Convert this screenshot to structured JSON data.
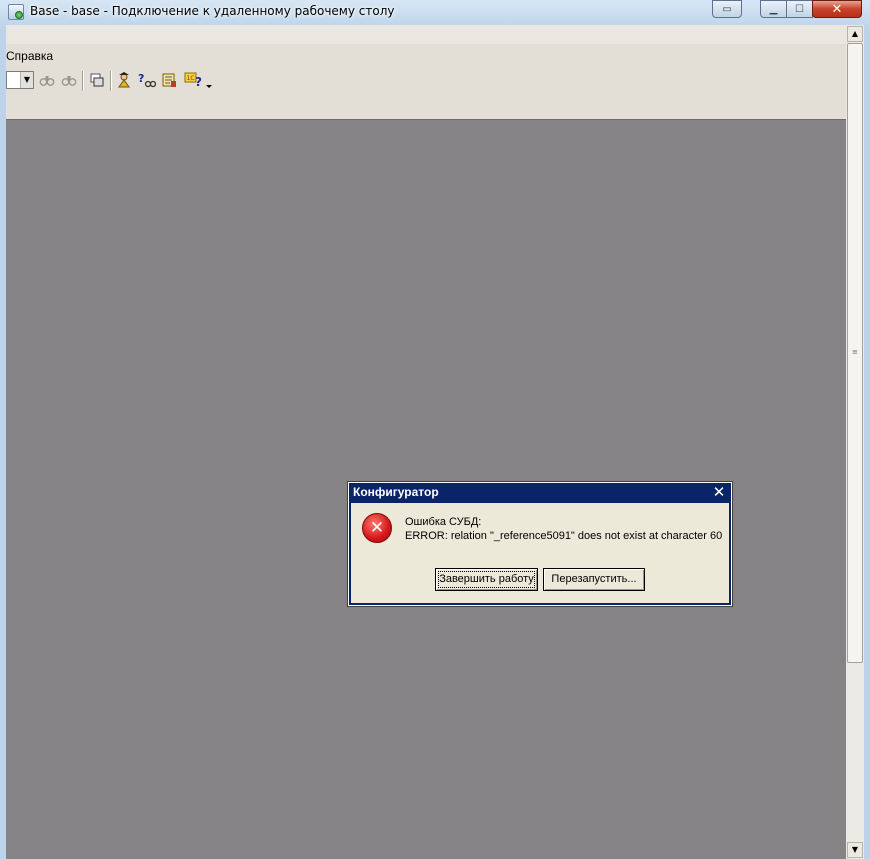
{
  "window": {
    "title": "Base - base - Подключение к удаленному рабочему столу",
    "connbar_icon": "connection-bar-icon",
    "controls": [
      "minimize-icon",
      "maximize-icon",
      "close-icon"
    ],
    "close_glyph": "✕",
    "minimize_glyph": "▁",
    "maximize_glyph": "☐"
  },
  "menubar": {
    "help_label": "Справка"
  },
  "toolbar": {
    "combo_arrow_glyph": "▼",
    "icons": [
      "binoculars-icon",
      "binoculars-disabled-icon",
      "windows-icon",
      "wizard-icon",
      "help-search-icon",
      "syntax-assistant-icon",
      "help-context-icon"
    ]
  },
  "scrollbar": {
    "up_glyph": "▲",
    "down_glyph": "▼",
    "grip_glyph": "≡"
  },
  "dialog": {
    "title": "Конфигуратор",
    "close_glyph": "✕",
    "error_icon_glyph": "✕",
    "message_line1": "Ошибка СУБД:",
    "message_line2": "ERROR:  relation \"_reference5091\" does not exist at character 60",
    "button_exit": "Завершить работу",
    "button_restart": "Перезапустить..."
  },
  "colors": {
    "desktop_gray": "#868386",
    "dialog_title_blue": "#0a246a",
    "dialog_body": "#ece9d8",
    "error_red": "#d4151b"
  }
}
